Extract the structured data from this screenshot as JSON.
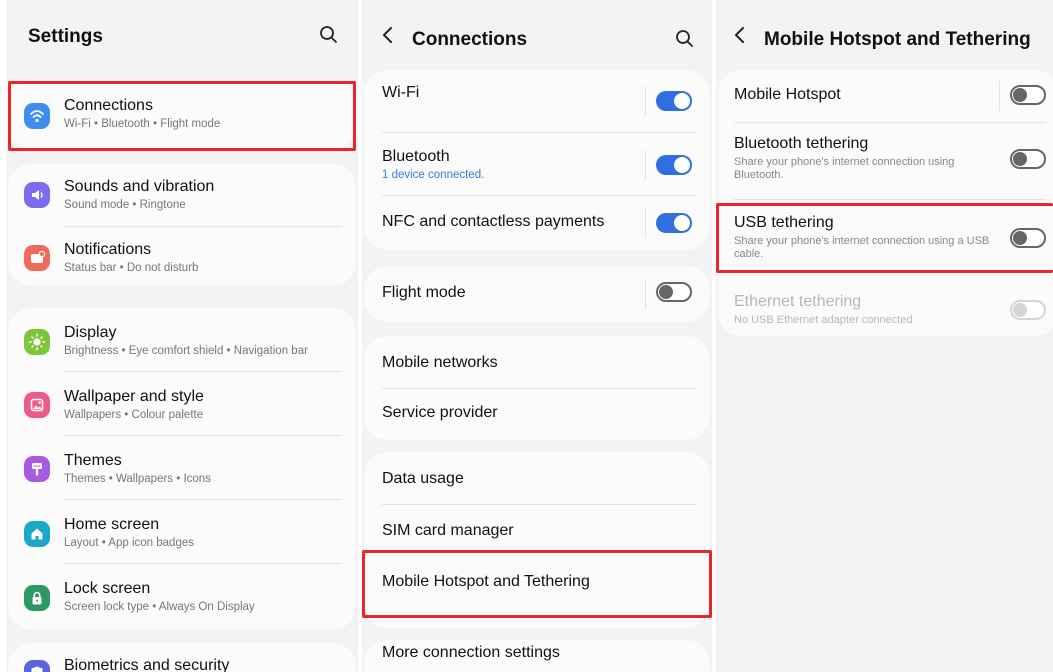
{
  "settings": {
    "title": "Settings",
    "items": [
      {
        "label": "Connections",
        "sub": "Wi-Fi  •  Bluetooth  •  Flight mode"
      },
      {
        "label": "Sounds and vibration",
        "sub": "Sound mode  •  Ringtone"
      },
      {
        "label": "Notifications",
        "sub": "Status bar  •  Do not disturb"
      },
      {
        "label": "Display",
        "sub": "Brightness  •  Eye comfort shield  •  Navigation bar"
      },
      {
        "label": "Wallpaper and style",
        "sub": "Wallpapers  •  Colour palette"
      },
      {
        "label": "Themes",
        "sub": "Themes  •  Wallpapers  •  Icons"
      },
      {
        "label": "Home screen",
        "sub": "Layout  •  App icon badges"
      },
      {
        "label": "Lock screen",
        "sub": "Screen lock type  •  Always On Display"
      },
      {
        "label": "Biometrics and security",
        "sub": ""
      }
    ]
  },
  "connections": {
    "title": "Connections",
    "wifi": {
      "label": "Wi-Fi",
      "state": "on"
    },
    "bluetooth": {
      "label": "Bluetooth",
      "sub": "1 device connected.",
      "state": "on"
    },
    "nfc": {
      "label": "NFC and contactless payments",
      "state": "on"
    },
    "flight": {
      "label": "Flight mode",
      "state": "off"
    },
    "mobile_networks": "Mobile networks",
    "service_provider": "Service provider",
    "data_usage": "Data usage",
    "sim_manager": "SIM card manager",
    "hotspot": "Mobile Hotspot and Tethering",
    "more": "More connection settings"
  },
  "hotspot": {
    "title": "Mobile Hotspot and Tethering",
    "mobile_hotspot": {
      "label": "Mobile Hotspot",
      "state": "off"
    },
    "bt_tethering": {
      "label": "Bluetooth tethering",
      "sub": "Share your phone's internet connection using Bluetooth.",
      "state": "off"
    },
    "usb_tethering": {
      "label": "USB tethering",
      "sub": "Share your phone's internet connection using a USB cable.",
      "state": "off"
    },
    "eth_tethering": {
      "label": "Ethernet tethering",
      "sub": "No USB Ethernet adapter connected",
      "state": "disabled"
    }
  },
  "icons": {
    "connections": "wifi-icon",
    "sounds": "speaker-icon",
    "notifications": "notification-icon",
    "display": "sun-icon",
    "wallpaper": "image-icon",
    "themes": "brush-icon",
    "home": "home-icon",
    "lock": "lock-icon",
    "biometrics": "shield-icon"
  },
  "colors": {
    "highlight": "#e8262b",
    "toggle_on": "#2f6fe0",
    "connections_icon": "#3d8cf0",
    "sounds_icon": "#7d6cf0",
    "notifications_icon": "#f26a5b",
    "display_icon": "#7dc63b",
    "wallpaper_icon": "#ee5a86",
    "themes_icon": "#a95be0",
    "home_icon": "#19a8c8",
    "lock_icon": "#2b9a62",
    "biometrics_icon": "#5a66e0"
  }
}
